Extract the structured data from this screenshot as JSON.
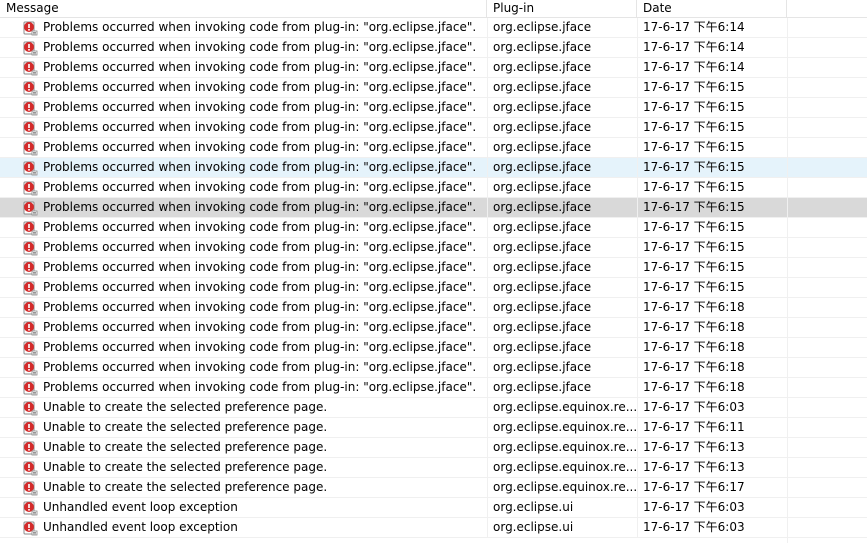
{
  "columns": {
    "message": "Message",
    "plugin": "Plug-in",
    "date": "Date"
  },
  "colors": {
    "hover_row": "#e5f3fb",
    "selected_row": "#d9d9d9",
    "error_icon": "#d42b2b"
  },
  "rows": [
    {
      "icon": "error-log-icon",
      "message": "Problems occurred when invoking code from plug-in: \"org.eclipse.jface\".",
      "plugin": "org.eclipse.jface",
      "date": "17-6-17 下午6:14"
    },
    {
      "icon": "error-log-icon",
      "message": "Problems occurred when invoking code from plug-in: \"org.eclipse.jface\".",
      "plugin": "org.eclipse.jface",
      "date": "17-6-17 下午6:14"
    },
    {
      "icon": "error-log-icon",
      "message": "Problems occurred when invoking code from plug-in: \"org.eclipse.jface\".",
      "plugin": "org.eclipse.jface",
      "date": "17-6-17 下午6:14"
    },
    {
      "icon": "error-log-icon",
      "message": "Problems occurred when invoking code from plug-in: \"org.eclipse.jface\".",
      "plugin": "org.eclipse.jface",
      "date": "17-6-17 下午6:15"
    },
    {
      "icon": "error-log-icon",
      "message": "Problems occurred when invoking code from plug-in: \"org.eclipse.jface\".",
      "plugin": "org.eclipse.jface",
      "date": "17-6-17 下午6:15"
    },
    {
      "icon": "error-log-icon",
      "message": "Problems occurred when invoking code from plug-in: \"org.eclipse.jface\".",
      "plugin": "org.eclipse.jface",
      "date": "17-6-17 下午6:15"
    },
    {
      "icon": "error-log-icon",
      "message": "Problems occurred when invoking code from plug-in: \"org.eclipse.jface\".",
      "plugin": "org.eclipse.jface",
      "date": "17-6-17 下午6:15"
    },
    {
      "icon": "error-log-icon",
      "message": "Problems occurred when invoking code from plug-in: \"org.eclipse.jface\".",
      "plugin": "org.eclipse.jface",
      "date": "17-6-17 下午6:15",
      "state": "hover"
    },
    {
      "icon": "error-log-icon",
      "message": "Problems occurred when invoking code from plug-in: \"org.eclipse.jface\".",
      "plugin": "org.eclipse.jface",
      "date": "17-6-17 下午6:15"
    },
    {
      "icon": "error-log-icon",
      "message": "Problems occurred when invoking code from plug-in: \"org.eclipse.jface\".",
      "plugin": "org.eclipse.jface",
      "date": "17-6-17 下午6:15",
      "state": "selected"
    },
    {
      "icon": "error-log-icon",
      "message": "Problems occurred when invoking code from plug-in: \"org.eclipse.jface\".",
      "plugin": "org.eclipse.jface",
      "date": "17-6-17 下午6:15"
    },
    {
      "icon": "error-log-icon",
      "message": "Problems occurred when invoking code from plug-in: \"org.eclipse.jface\".",
      "plugin": "org.eclipse.jface",
      "date": "17-6-17 下午6:15"
    },
    {
      "icon": "error-log-icon",
      "message": "Problems occurred when invoking code from plug-in: \"org.eclipse.jface\".",
      "plugin": "org.eclipse.jface",
      "date": "17-6-17 下午6:15"
    },
    {
      "icon": "error-log-icon",
      "message": "Problems occurred when invoking code from plug-in: \"org.eclipse.jface\".",
      "plugin": "org.eclipse.jface",
      "date": "17-6-17 下午6:15"
    },
    {
      "icon": "error-log-icon",
      "message": "Problems occurred when invoking code from plug-in: \"org.eclipse.jface\".",
      "plugin": "org.eclipse.jface",
      "date": "17-6-17 下午6:18"
    },
    {
      "icon": "error-log-icon",
      "message": "Problems occurred when invoking code from plug-in: \"org.eclipse.jface\".",
      "plugin": "org.eclipse.jface",
      "date": "17-6-17 下午6:18"
    },
    {
      "icon": "error-log-icon",
      "message": "Problems occurred when invoking code from plug-in: \"org.eclipse.jface\".",
      "plugin": "org.eclipse.jface",
      "date": "17-6-17 下午6:18"
    },
    {
      "icon": "error-log-icon",
      "message": "Problems occurred when invoking code from plug-in: \"org.eclipse.jface\".",
      "plugin": "org.eclipse.jface",
      "date": "17-6-17 下午6:18"
    },
    {
      "icon": "error-log-icon",
      "message": "Problems occurred when invoking code from plug-in: \"org.eclipse.jface\".",
      "plugin": "org.eclipse.jface",
      "date": "17-6-17 下午6:18"
    },
    {
      "icon": "error-log-icon",
      "message": "Unable to create the selected preference page.",
      "plugin": "org.eclipse.equinox.re...",
      "date": "17-6-17 下午6:03"
    },
    {
      "icon": "error-log-icon",
      "message": "Unable to create the selected preference page.",
      "plugin": "org.eclipse.equinox.re...",
      "date": "17-6-17 下午6:11"
    },
    {
      "icon": "error-log-icon",
      "message": "Unable to create the selected preference page.",
      "plugin": "org.eclipse.equinox.re...",
      "date": "17-6-17 下午6:13"
    },
    {
      "icon": "error-log-icon",
      "message": "Unable to create the selected preference page.",
      "plugin": "org.eclipse.equinox.re...",
      "date": "17-6-17 下午6:13"
    },
    {
      "icon": "error-log-icon",
      "message": "Unable to create the selected preference page.",
      "plugin": "org.eclipse.equinox.re...",
      "date": "17-6-17 下午6:17"
    },
    {
      "icon": "error-log-icon",
      "message": "Unhandled event loop exception",
      "plugin": "org.eclipse.ui",
      "date": "17-6-17 下午6:03"
    },
    {
      "icon": "error-log-icon",
      "message": "Unhandled event loop exception",
      "plugin": "org.eclipse.ui",
      "date": "17-6-17 下午6:03"
    }
  ]
}
